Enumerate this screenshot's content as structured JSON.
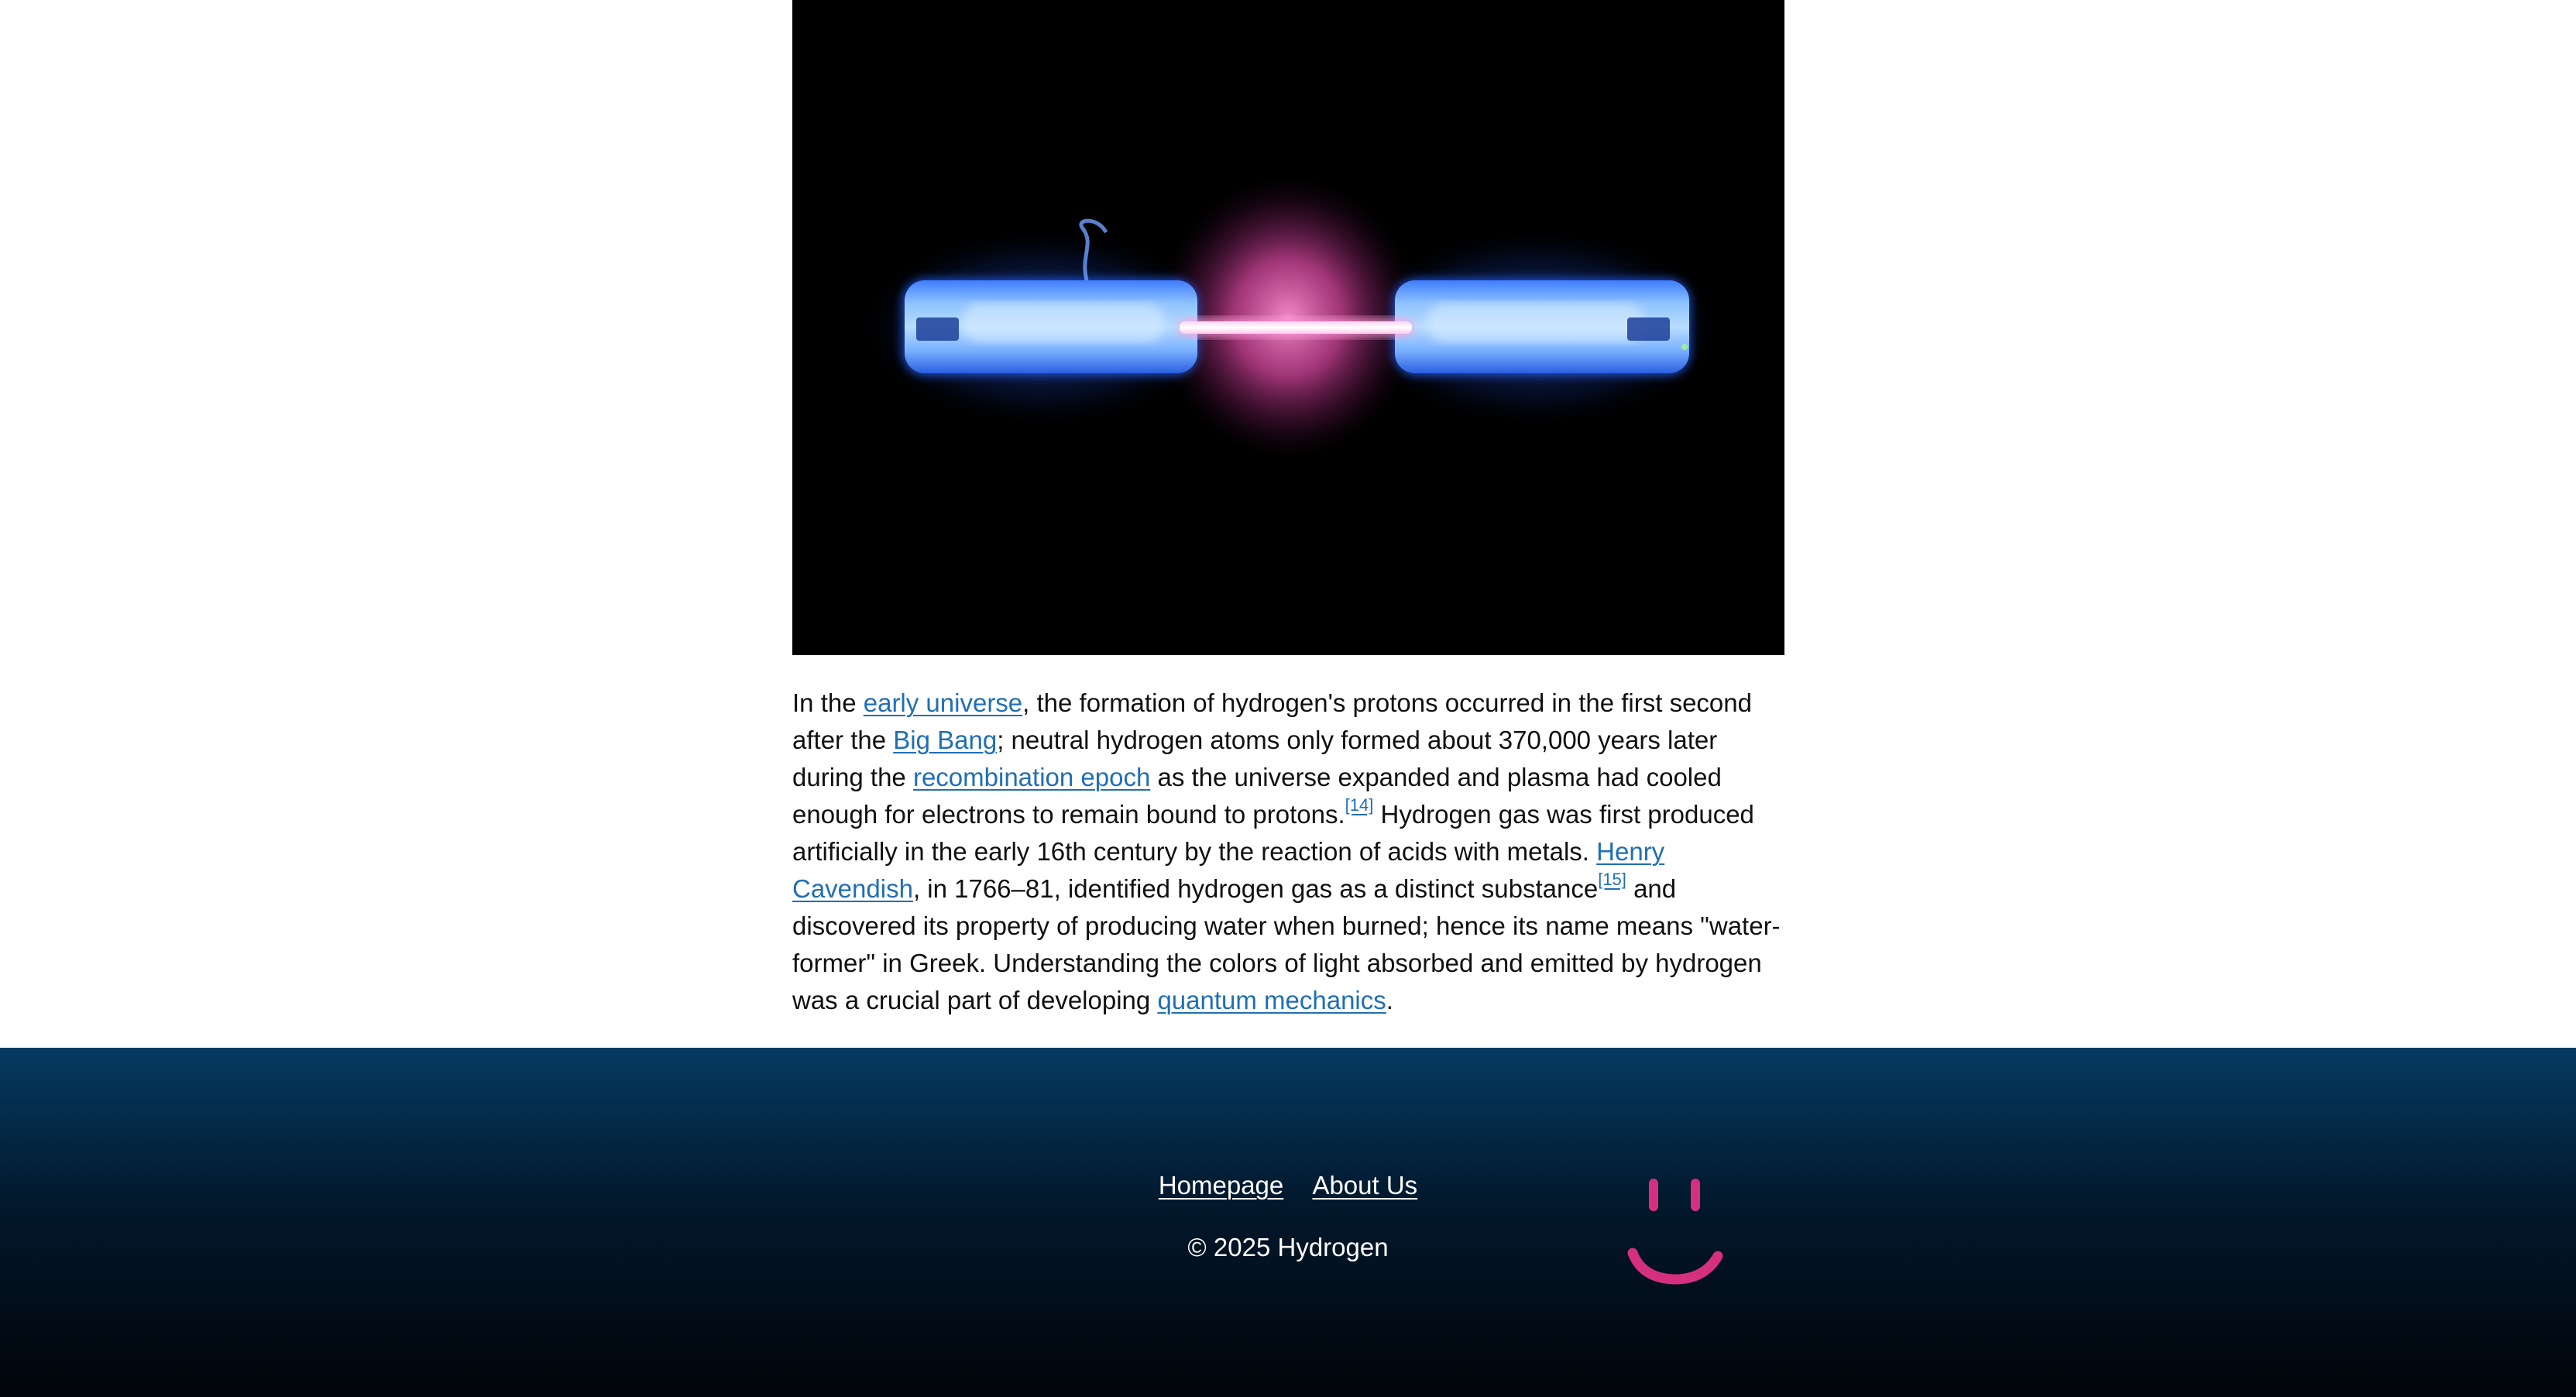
{
  "article": {
    "intro": "In the ",
    "link_early_universe": "early universe",
    "text_1": ", the formation of hydrogen's protons occurred in the first second after the ",
    "link_big_bang": "Big Bang",
    "text_2": "; neutral hydrogen atoms only formed about 370,000 years later during the ",
    "link_recombination_epoch": "recombination epoch",
    "text_3": " as the universe expanded and plasma had cooled enough for electrons to remain bound to protons.",
    "ref_14": "[14]",
    "text_4": " Hydrogen gas was first produced artificially in the early 16th century by the reaction of acids with metals. ",
    "link_henry_cavendish": "Henry Cavendish",
    "text_5": ", in 1766–81, identified hydrogen gas as a distinct substance",
    "ref_15": "[15]",
    "text_6": " and discovered its property of producing water when burned; hence its name means \"water-former\" in Greek. Understanding the colors of light absorbed and emitted by hydrogen was a crucial part of developing ",
    "link_quantum_mechanics": "quantum mechanics",
    "text_7": "."
  },
  "footer": {
    "nav": {
      "homepage": "Homepage",
      "about_us": "About Us"
    },
    "copyright": "© 2025 Hydrogen"
  },
  "colors": {
    "link": "#1f6fb5",
    "footer_top": "#053a62",
    "footer_bottom": "#010409",
    "smiley": "#d5307f",
    "glow_blue": "#3a8cff",
    "glow_pink": "#ff5ab4"
  },
  "icons": {
    "hero": "hydrogen-discharge-tube-image",
    "smiley": "smiley-face-icon"
  }
}
